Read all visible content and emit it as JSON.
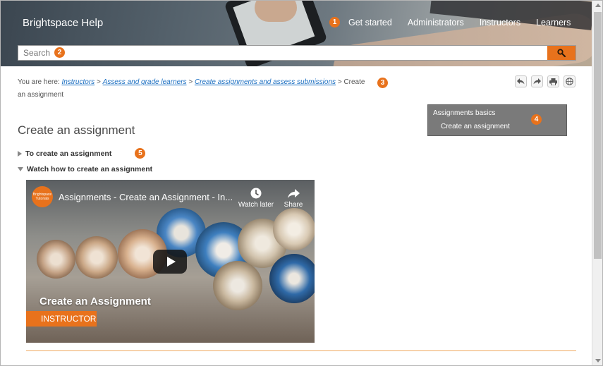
{
  "header": {
    "site_title": "Brightspace Help",
    "nav": [
      {
        "label": "Get started",
        "badge": "1"
      },
      {
        "label": "Administrators"
      },
      {
        "label": "Instructors"
      },
      {
        "label": "Learners"
      }
    ]
  },
  "search": {
    "placeholder": "Search",
    "badge": "2",
    "button_icon": "search-icon"
  },
  "breadcrumb": {
    "prefix": "You are here:",
    "links": [
      "Instructors",
      "Assess and grade learners",
      "Create assignments and assess submissions"
    ],
    "current": "Create an assignment",
    "badge": "3"
  },
  "tools": [
    "back-arrow-icon",
    "forward-arrow-icon",
    "print-icon",
    "globe-icon"
  ],
  "toc": {
    "heading": "Assignments basics",
    "item": "Create an assignment",
    "badge": "4"
  },
  "main": {
    "title": "Create an assignment",
    "sections": [
      {
        "label": "To create an assignment",
        "expanded": false,
        "badge": "5"
      },
      {
        "label": "Watch how to create an assignment",
        "expanded": true
      }
    ]
  },
  "video": {
    "logo_text": "Brightspace Tutorials",
    "title": "Assignments - Create an Assignment - In...",
    "watch_later": "Watch later",
    "share": "Share",
    "overlay_title": "Create an Assignment",
    "overlay_tag": "INSTRUCTOR"
  },
  "colors": {
    "accent": "#e8721c",
    "link": "#1a6ec1",
    "toc_bg": "#7a7a7a"
  }
}
